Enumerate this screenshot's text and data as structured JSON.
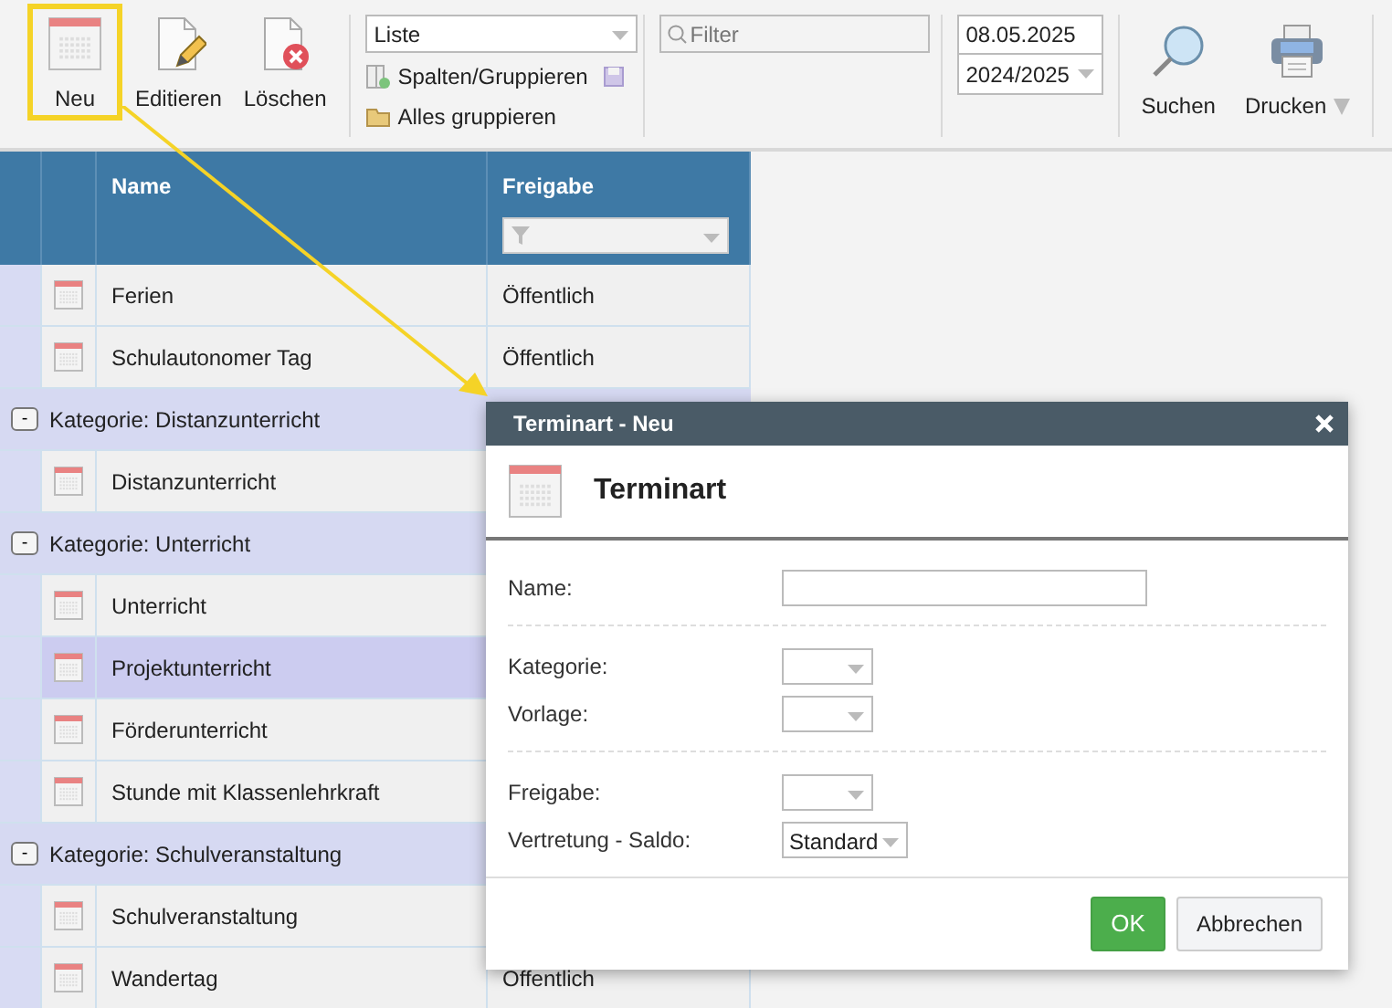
{
  "toolbar": {
    "buttons": [
      {
        "label": "Neu",
        "highlighted": true
      },
      {
        "label": "Editieren",
        "highlighted": false
      },
      {
        "label": "Löschen",
        "highlighted": false
      }
    ],
    "view_select": {
      "value": "Liste"
    },
    "links": [
      {
        "label": "Spalten/Gruppieren"
      },
      {
        "label": "Alles gruppieren"
      }
    ],
    "filter": {
      "placeholder": "Filter"
    },
    "date": {
      "value": "08.05.2025"
    },
    "year_select": {
      "value": "2024/2025"
    },
    "actions": [
      {
        "label": "Suchen",
        "dropdown": false
      },
      {
        "label": "Drucken",
        "dropdown": true
      }
    ]
  },
  "grid": {
    "columns": [
      {
        "label": "Name"
      },
      {
        "label": "Freigabe",
        "filter": true
      }
    ],
    "rows": [
      {
        "kind": "item",
        "name": "Ferien",
        "freigabe": "Öffentlich",
        "selected": false
      },
      {
        "kind": "item",
        "name": "Schulautonomer Tag",
        "freigabe": "Öffentlich",
        "selected": false
      },
      {
        "kind": "group",
        "toggle": "-",
        "label": "Kategorie: Distanzunterricht"
      },
      {
        "kind": "item",
        "name": "Distanzunterricht",
        "selected": false
      },
      {
        "kind": "group",
        "toggle": "-",
        "label": "Kategorie: Unterricht"
      },
      {
        "kind": "item",
        "name": "Unterricht",
        "selected": false
      },
      {
        "kind": "item",
        "name": "Projektunterricht",
        "selected": true
      },
      {
        "kind": "item",
        "name": "Förderunterricht",
        "selected": false
      },
      {
        "kind": "item",
        "name": "Stunde mit Klassenlehrkraft",
        "selected": false
      },
      {
        "kind": "group",
        "toggle": "-",
        "label": "Kategorie: Schulveranstaltung"
      },
      {
        "kind": "item",
        "name": "Schulveranstaltung",
        "selected": false
      },
      {
        "kind": "item",
        "name": "Wandertag",
        "freigabe": "Öffentlich",
        "selected": false
      }
    ]
  },
  "dialog": {
    "title": "Terminart - Neu",
    "heading": "Terminart",
    "sections": [
      [
        {
          "label": "Name:",
          "kind": "text"
        }
      ],
      [
        {
          "label": "Kategorie:",
          "kind": "select"
        },
        {
          "label": "Vorlage:",
          "kind": "select"
        }
      ],
      [
        {
          "label": "Freigabe:",
          "kind": "select"
        },
        {
          "label": "Vertretung - Saldo:",
          "kind": "select",
          "value": "Standard"
        }
      ]
    ],
    "buttons": [
      {
        "label": "OK",
        "kind": "primary"
      },
      {
        "label": "Abbrechen",
        "kind": "secondary"
      }
    ]
  }
}
